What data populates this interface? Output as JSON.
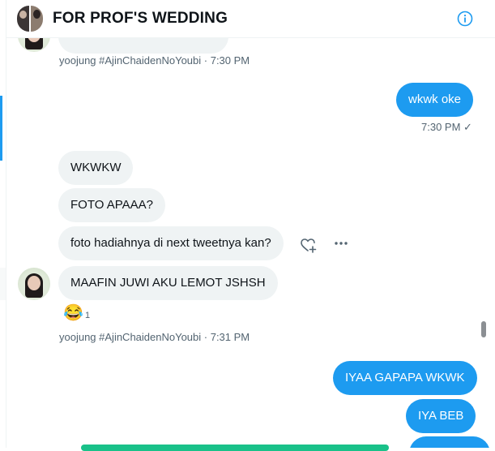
{
  "header": {
    "title": "FOR PROF'S WEDDING",
    "info_icon": "info-circle-icon"
  },
  "messages": {
    "partial_meta": "yoojung #AjinChaidenNoYoubi · 7:30 PM",
    "out_1": "wkwk oke",
    "out_1_meta": "7:30 PM ✓",
    "in_1": "WKWKW",
    "in_2": "FOTO APAAA?",
    "in_3": "foto hadiahnya di next tweetnya kan?",
    "in_4": "MAAFIN JUWI AKU LEMOT JSHSH",
    "reaction_emoji": "😂",
    "reaction_count": "1",
    "in_meta": "yoojung #AjinChaidenNoYoubi · 7:31 PM",
    "out_2": "IYAA GAPAPA WKWK",
    "out_3": "IYA BEB"
  },
  "icons": {
    "react": "heart-plus-icon",
    "more": "more-horizontal-icon"
  },
  "colors": {
    "accent": "#1d9bf0",
    "incoming_bubble": "#eff3f4",
    "meta_text": "#536471"
  }
}
